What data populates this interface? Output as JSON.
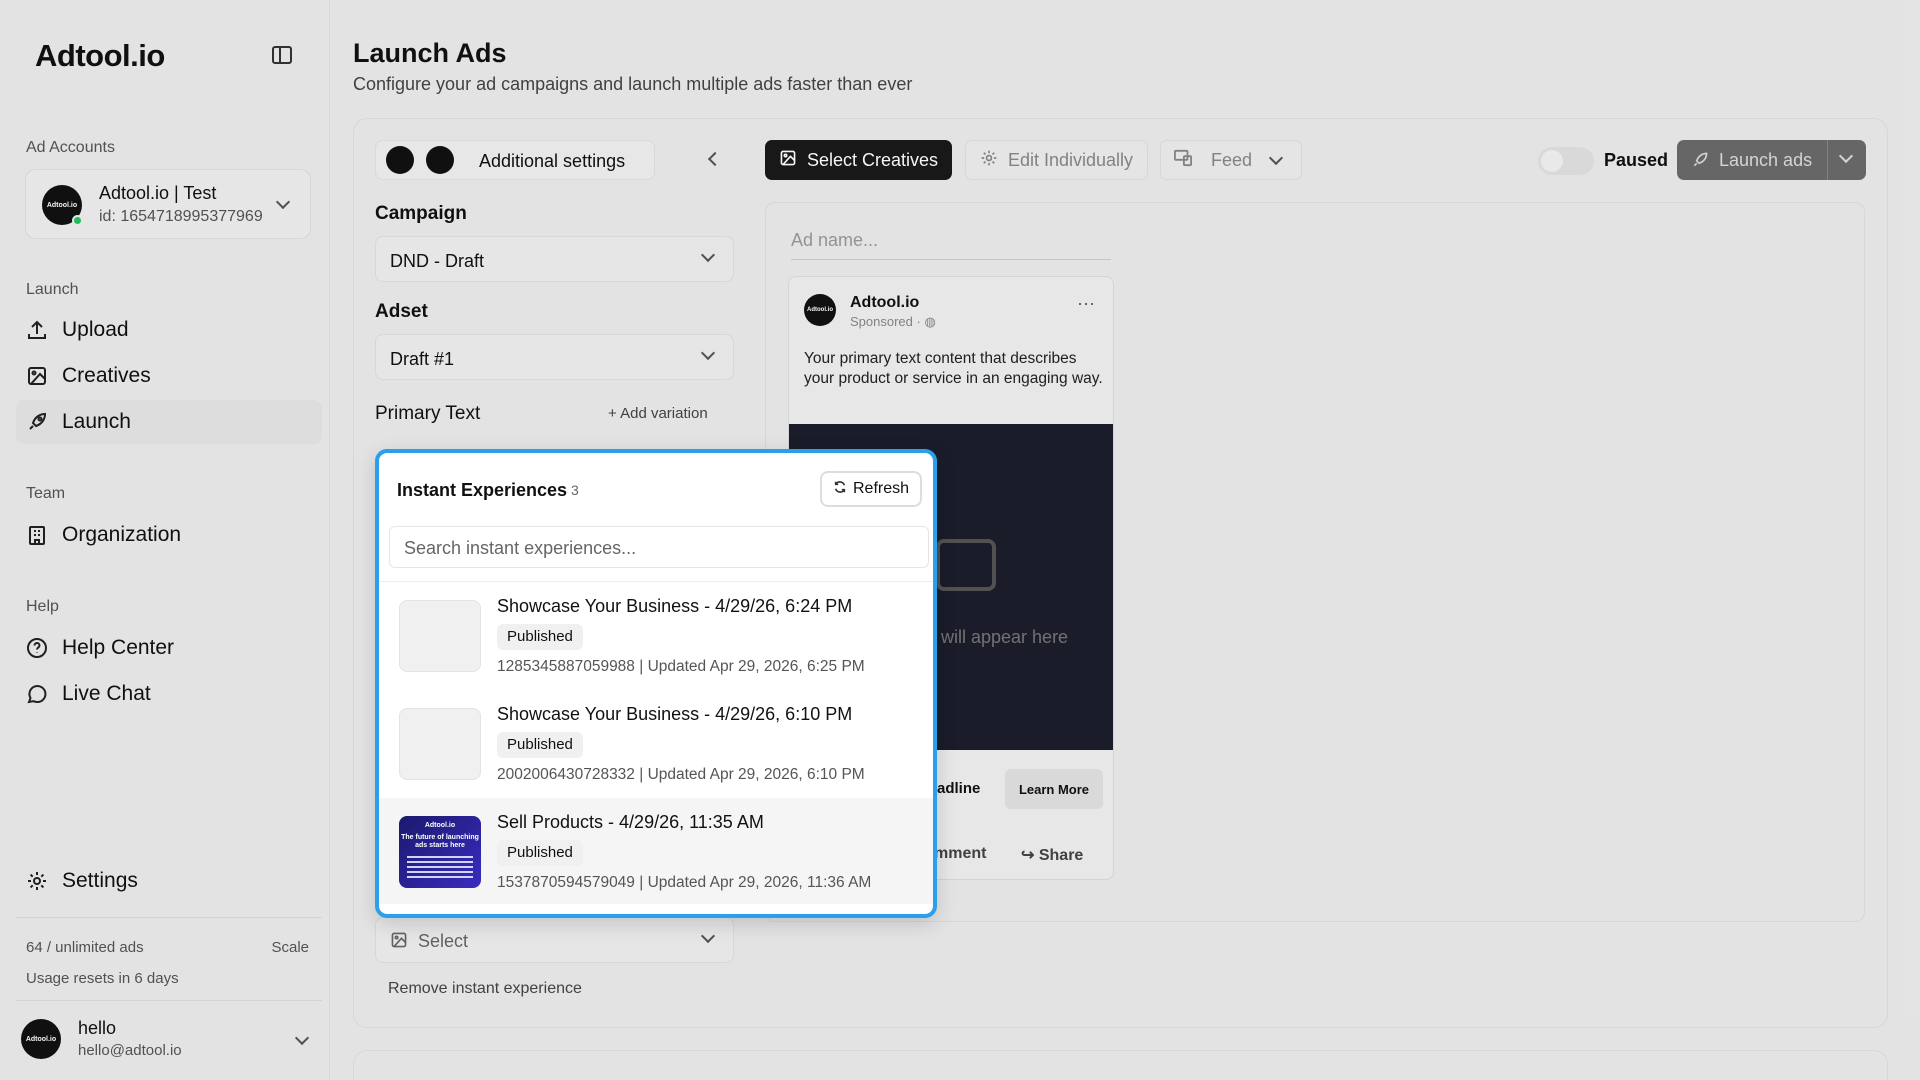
{
  "app": {
    "logo": "Adtool.io"
  },
  "sidebar": {
    "ad_accounts_label": "Ad Accounts",
    "account": {
      "avatar_text": "Adtool.io",
      "name": "Adtool.io | Test",
      "id": "id: 1654718995377969"
    },
    "launch_label": "Launch",
    "launch_items": [
      {
        "label": "Upload",
        "icon": "upload-icon"
      },
      {
        "label": "Creatives",
        "icon": "image-icon"
      },
      {
        "label": "Launch",
        "icon": "rocket-icon"
      }
    ],
    "team_label": "Team",
    "team_items": [
      {
        "label": "Organization",
        "icon": "building-icon"
      }
    ],
    "help_label": "Help",
    "help_items": [
      {
        "label": "Help Center",
        "icon": "help-circle-icon"
      },
      {
        "label": "Live Chat",
        "icon": "chat-icon"
      }
    ],
    "settings_label": "Settings",
    "usage": "64 / unlimited ads",
    "scale": "Scale",
    "resets": "Usage resets in 6 days",
    "user": {
      "avatar_text": "Adtool.io",
      "name": "hello",
      "email": "hello@adtool.io"
    }
  },
  "page": {
    "title": "Launch Ads",
    "subtitle": "Configure your ad campaigns and launch multiple ads faster than ever"
  },
  "form": {
    "additional_settings": "Additional settings",
    "campaign_label": "Campaign",
    "campaign_value": "DND - Draft",
    "adset_label": "Adset",
    "adset_value": "Draft #1",
    "primary_text_label": "Primary Text",
    "add_variation": "Add variation",
    "select_placeholder": "Select",
    "remove_ie": "Remove instant experience"
  },
  "toolbar": {
    "select_creatives": "Select Creatives",
    "edit_individually": "Edit Individually",
    "feed": "Feed",
    "paused": "Paused",
    "launch_ads": "Launch ads"
  },
  "preview": {
    "ad_name_placeholder": "Ad name...",
    "page_name": "Adtool.io",
    "sponsored": "Sponsored · ",
    "primary_text": "Your primary text content that describes your product or service in an engaging way.",
    "image_note": "will appear here",
    "headline": "adline",
    "cta": "Learn More",
    "comment": "mment",
    "share": "Share"
  },
  "instant_experiences": {
    "title": "Instant Experiences",
    "count": "3",
    "refresh": "Refresh",
    "search_placeholder": "Search instant experiences...",
    "items": [
      {
        "title": "Showcase Your Business - 4/29/26, 6:24 PM",
        "status": "Published",
        "meta": "1285345887059988 | Updated Apr 29, 2026, 6:25 PM"
      },
      {
        "title": "Showcase Your Business - 4/29/26, 6:10 PM",
        "status": "Published",
        "meta": "2002006430728332 | Updated Apr 29, 2026, 6:10 PM"
      },
      {
        "title": "Sell Products - 4/29/26, 11:35 AM",
        "status": "Published",
        "meta": "1537870594579049 | Updated Apr 29, 2026, 11:36 AM",
        "thumb_brand": "Adtool.io",
        "thumb_headline": "The future of launching ads starts here"
      }
    ]
  },
  "colors": {
    "accent": "#2aa0ec",
    "dark": "#1a1a1a",
    "online": "#22c55e"
  }
}
